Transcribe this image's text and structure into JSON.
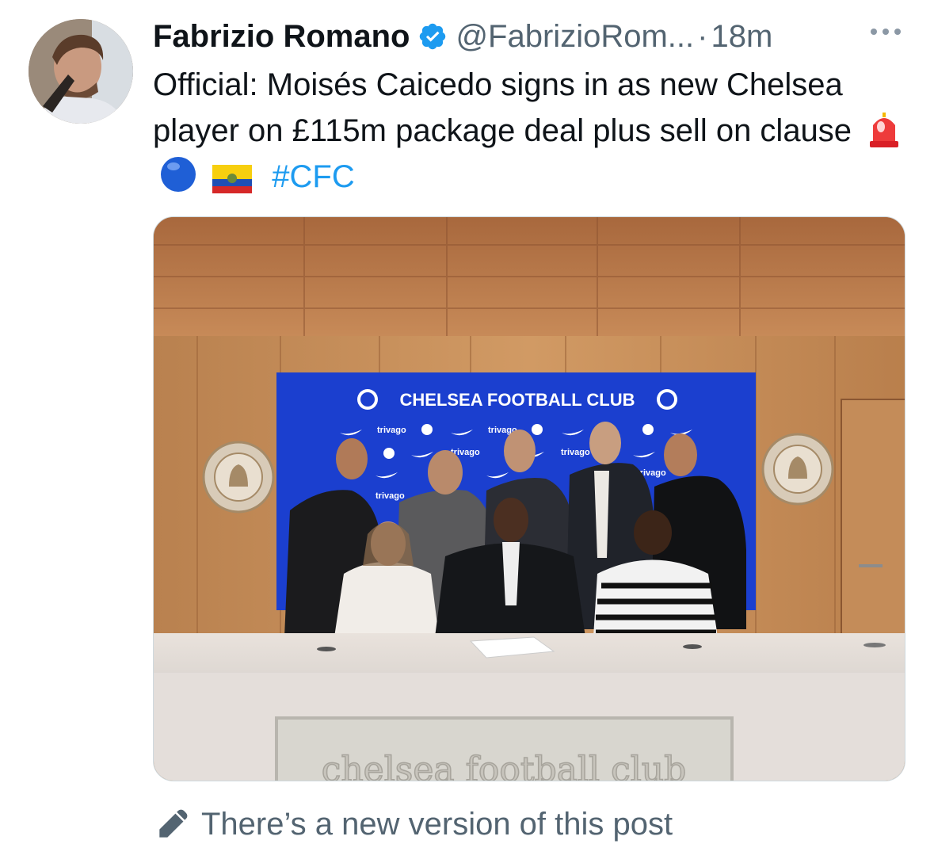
{
  "author": {
    "name": "Fabrizio Romano",
    "handle": "@FabrizioRom...",
    "dot": "·",
    "time": "18m"
  },
  "post": {
    "text_main": "Official: Moisés Caicedo signs in as new Chelsea player on £115m package deal plus sell on clause",
    "hashtag": "#CFC",
    "emojis": [
      "police-light-icon",
      "blue-circle-icon",
      "ecuador-flag-icon"
    ]
  },
  "photo": {
    "banner_title": "CHELSEA FOOTBALL CLUB",
    "sponsor": "trivago",
    "desk_sign": "chelsea football club",
    "crest_top": "CHELSEA",
    "crest_bottom": "FOOTBALL CLUB"
  },
  "edit_notice": "There’s a new version of this post",
  "colors": {
    "link": "#1d9bf0",
    "verified": "#1d9bf0",
    "muted": "#536471",
    "banner": "#1b3fcf"
  }
}
